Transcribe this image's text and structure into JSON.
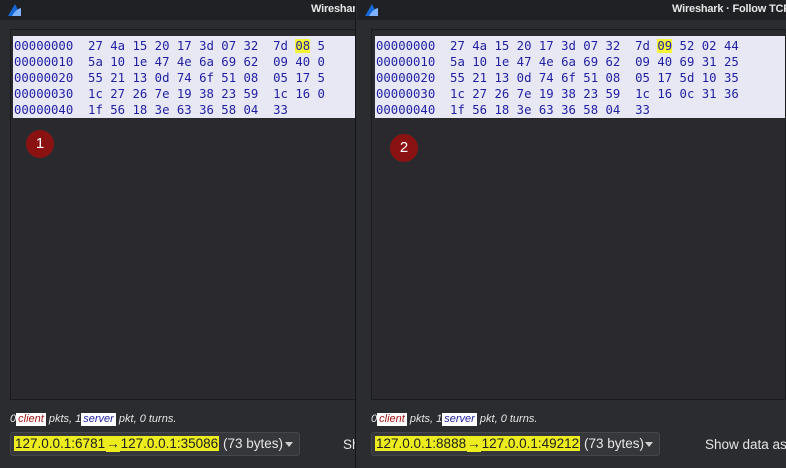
{
  "windows": [
    {
      "title": "Wireshark",
      "hex_rows": [
        {
          "offset": "00000000",
          "bytes": "27 4a 15 20 17 3d 07 32  7d",
          "highlight": "08",
          "rest": " 5"
        },
        {
          "offset": "00000010",
          "bytes": "5a 10 1e 47 4e 6a 69 62  09 40 0",
          "highlight": "",
          "rest": ""
        },
        {
          "offset": "00000020",
          "bytes": "55 21 13 0d 74 6f 51 08  05 17 5",
          "highlight": "",
          "rest": ""
        },
        {
          "offset": "00000030",
          "bytes": "1c 27 26 7e 19 38 23 59  1c 16 0",
          "highlight": "",
          "rest": ""
        },
        {
          "offset": "00000040",
          "bytes": "1f 56 18 3e 63 36 58 04  33",
          "highlight": "",
          "rest": ""
        }
      ],
      "badge": "1",
      "status": {
        "count1": "0",
        "client": "client",
        "mid": "pkts, 1",
        "server": "server",
        "tail": "pkt, 0 turns."
      },
      "conversation": {
        "from": "127.0.0.1:6781",
        "arrow": "→",
        "to": "127.0.0.1:35086",
        "size": "(73 bytes)"
      },
      "show_label": "Sh"
    },
    {
      "title": "Wireshark · Follow TCP",
      "hex_rows": [
        {
          "offset": "00000000",
          "bytes": "27 4a 15 20 17 3d 07 32  7d",
          "highlight": "09",
          "rest": " 52 02 44"
        },
        {
          "offset": "00000010",
          "bytes": "5a 10 1e 47 4e 6a 69 62  09 40 69 31 25",
          "highlight": "",
          "rest": ""
        },
        {
          "offset": "00000020",
          "bytes": "55 21 13 0d 74 6f 51 08  05 17 5d 10 35",
          "highlight": "",
          "rest": ""
        },
        {
          "offset": "00000030",
          "bytes": "1c 27 26 7e 19 38 23 59  1c 16 0c 31 36",
          "highlight": "",
          "rest": ""
        },
        {
          "offset": "00000040",
          "bytes": "1f 56 18 3e 63 36 58 04  33",
          "highlight": "",
          "rest": ""
        }
      ],
      "badge": "2",
      "status": {
        "count1": "0",
        "client": "client",
        "mid": "pkts, 1",
        "server": "server",
        "tail": "pkt, 0 turns."
      },
      "conversation": {
        "from": "127.0.0.1:8888",
        "arrow": "→",
        "to": "127.0.0.1:49212",
        "size": "(73 bytes)"
      },
      "show_label": "Show data as"
    }
  ],
  "icons": {
    "app": "wireshark-fin-icon",
    "dropdown": "chevron-down-icon"
  },
  "colors": {
    "hex_text": "#1f1fa5",
    "hex_bg": "#e8e8f4",
    "highlight": "#f5f537",
    "badge": "#8b1212",
    "address_highlight": "#ecec1f"
  }
}
